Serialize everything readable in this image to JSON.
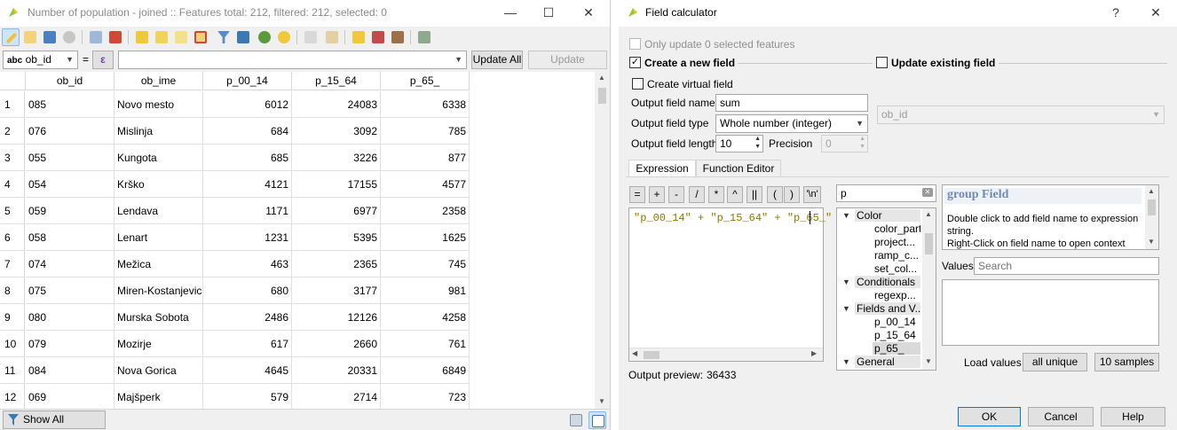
{
  "attribute_table": {
    "title": "Number of population - joined :: Features total: 212, filtered: 212, selected: 0",
    "window_controls": {
      "minimize": "—",
      "maximize": "☐",
      "close": "✕"
    },
    "field_combo": {
      "prefix": "abc",
      "value": "ob_id"
    },
    "equals": "=",
    "epsilon": "ε",
    "update_all": "Update All",
    "update_selected": "Update Selected",
    "columns": [
      "ob_id",
      "ob_ime",
      "p_00_14",
      "p_15_64",
      "p_65_"
    ],
    "rows": [
      {
        "n": "1",
        "ob_id": "085",
        "ob_ime": "Novo mesto",
        "p_00_14": "6012",
        "p_15_64": "24083",
        "p_65_": "6338"
      },
      {
        "n": "2",
        "ob_id": "076",
        "ob_ime": "Mislinja",
        "p_00_14": "684",
        "p_15_64": "3092",
        "p_65_": "785"
      },
      {
        "n": "3",
        "ob_id": "055",
        "ob_ime": "Kungota",
        "p_00_14": "685",
        "p_15_64": "3226",
        "p_65_": "877"
      },
      {
        "n": "4",
        "ob_id": "054",
        "ob_ime": "Krško",
        "p_00_14": "4121",
        "p_15_64": "17155",
        "p_65_": "4577"
      },
      {
        "n": "5",
        "ob_id": "059",
        "ob_ime": "Lendava",
        "p_00_14": "1171",
        "p_15_64": "6977",
        "p_65_": "2358"
      },
      {
        "n": "6",
        "ob_id": "058",
        "ob_ime": "Lenart",
        "p_00_14": "1231",
        "p_15_64": "5395",
        "p_65_": "1625"
      },
      {
        "n": "7",
        "ob_id": "074",
        "ob_ime": "Mežica",
        "p_00_14": "463",
        "p_15_64": "2365",
        "p_65_": "745"
      },
      {
        "n": "8",
        "ob_id": "075",
        "ob_ime": "Miren-Kostanjevica",
        "p_00_14": "680",
        "p_15_64": "3177",
        "p_65_": "981"
      },
      {
        "n": "9",
        "ob_id": "080",
        "ob_ime": "Murska Sobota",
        "p_00_14": "2486",
        "p_15_64": "12126",
        "p_65_": "4258"
      },
      {
        "n": "10",
        "ob_id": "079",
        "ob_ime": "Mozirje",
        "p_00_14": "617",
        "p_15_64": "2660",
        "p_65_": "761"
      },
      {
        "n": "11",
        "ob_id": "084",
        "ob_ime": "Nova Gorica",
        "p_00_14": "4645",
        "p_15_64": "20331",
        "p_65_": "6849"
      },
      {
        "n": "12",
        "ob_id": "069",
        "ob_ime": "Majšperk",
        "p_00_14": "579",
        "p_15_64": "2714",
        "p_65_": "723"
      }
    ],
    "show_all_features": "Show All Features"
  },
  "field_calculator": {
    "title": "Field calculator",
    "help_glyph": "?",
    "close_glyph": "✕",
    "only_update_selected": "Only update 0 selected features",
    "create_new_field": "Create a new field",
    "update_existing_field": "Update existing field",
    "create_virtual_field": "Create virtual field",
    "output_field_name_label": "Output field name",
    "output_field_name": "sum",
    "output_field_type_label": "Output field type",
    "output_field_type": "Whole number (integer)",
    "output_field_length_label": "Output field length",
    "output_field_length": "10",
    "precision_label": "Precision",
    "precision": "0",
    "existing_field": "ob_id",
    "tabs": [
      "Expression",
      "Function Editor"
    ],
    "operators": [
      "=",
      "+",
      "-",
      "/",
      "*",
      "^",
      "||",
      "(",
      ")",
      "'\\n'"
    ],
    "expression": "\"p_00_14\" + \"p_15_64\" + \"p_65_\"",
    "search_value": "p",
    "tree": [
      {
        "label": "Color",
        "kind": "group"
      },
      {
        "label": "color_part",
        "kind": "item"
      },
      {
        "label": "project...",
        "kind": "item"
      },
      {
        "label": "ramp_c...",
        "kind": "item"
      },
      {
        "label": "set_col...",
        "kind": "item"
      },
      {
        "label": "Conditionals",
        "kind": "group"
      },
      {
        "label": "regexp...",
        "kind": "item"
      },
      {
        "label": "Fields and V...",
        "kind": "group"
      },
      {
        "label": "p_00_14",
        "kind": "item"
      },
      {
        "label": "p_15_64",
        "kind": "item"
      },
      {
        "label": "p_65_",
        "kind": "item-selected"
      },
      {
        "label": "General",
        "kind": "group"
      }
    ],
    "help_title": "group Field",
    "help_text_1": "Double click to add field name to expression",
    "help_text_2": "string.",
    "help_text_3": "Right-Click on field name to open context",
    "values_label": "Values",
    "values_search_placeholder": "Search",
    "load_values_label": "Load values",
    "all_unique": "all unique",
    "ten_samples": "10 samples",
    "output_preview_label": "Output preview:",
    "output_preview_value": "36433",
    "ok": "OK",
    "cancel": "Cancel",
    "help": "Help"
  }
}
